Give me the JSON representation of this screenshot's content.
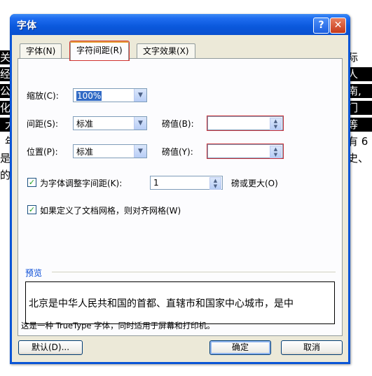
{
  "background_doc": {
    "left_lines": [
      "关和",
      "经济",
      "公用",
      "化省",
      "大",
      "年",
      "是世",
      "的央"
    ],
    "right_lines": [
      "际",
      "人",
      "南,",
      "门",
      "等",
      "有 6",
      "史、"
    ]
  },
  "window": {
    "title": "字体",
    "help_label": "?",
    "close_label": "✕"
  },
  "tabs": [
    {
      "label": "字体(N)",
      "active": false
    },
    {
      "label": "字符间距(R)",
      "active": true
    },
    {
      "label": "文字效果(X)",
      "active": false
    }
  ],
  "form": {
    "scale_label": "缩放(C):",
    "scale_value": "100%",
    "spacing_label": "间距(S):",
    "spacing_value": "标准",
    "spacing_pt_label": "磅值(B):",
    "spacing_pt_value": "",
    "position_label": "位置(P):",
    "position_value": "标准",
    "position_pt_label": "磅值(Y):",
    "position_pt_value": "",
    "kerning_checked": true,
    "kerning_label": "为字体调整字间距(K):",
    "kerning_value": "1",
    "kerning_suffix": "磅或更大(O)",
    "grid_checked": true,
    "grid_label": "如果定义了文档网格，则对齐网格(W)"
  },
  "preview": {
    "title": "预览",
    "text": "北京是中华人民共和国的首都、直辖市和国家中心城市，是中"
  },
  "note": "这是一种 TrueType 字体，同时适用于屏幕和打印机。",
  "buttons": {
    "default_label": "默认(D)...",
    "ok_label": "确定",
    "cancel_label": "取消"
  },
  "icons": {
    "dropdown": "chevron-down-icon",
    "spinner": "spinner-updown-icon",
    "check": "checkmark-icon"
  }
}
